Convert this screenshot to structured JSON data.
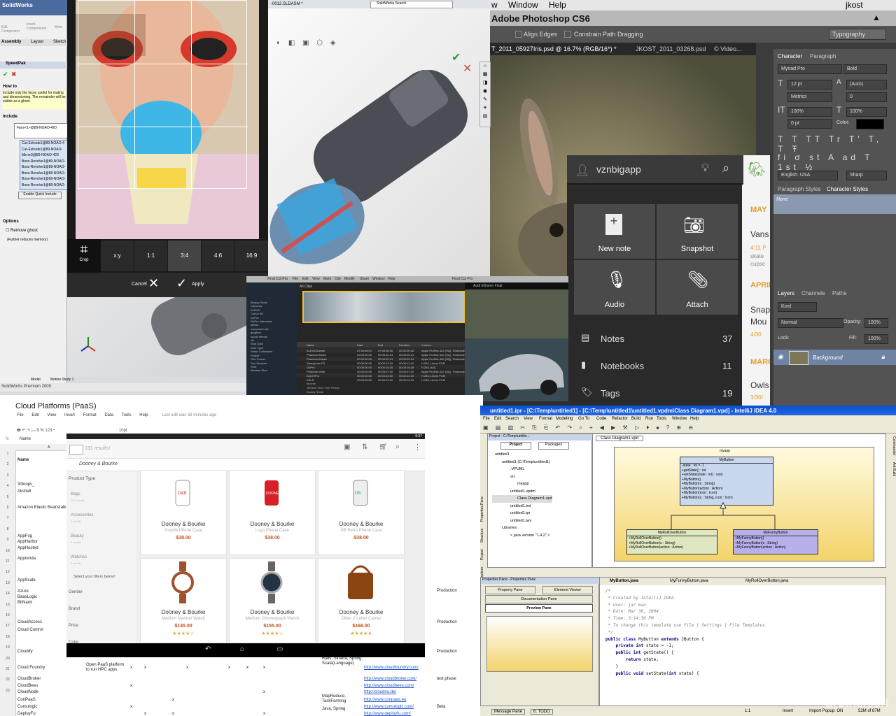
{
  "photoshop": {
    "menu": [
      "w",
      "Window",
      "Help"
    ],
    "user": "jkost",
    "app_title": "Adobe Photoshop CS6",
    "options": {
      "align_edges": "Align Edges",
      "constrain": "Constrain Path Dragging",
      "workspace": "Typography"
    },
    "doc_tabs": [
      "T_2011_05927Iris.psd @ 16.7% (RGB/16*) *",
      "JKOST_2011_03268.psd",
      "© Video..."
    ],
    "char_tabs": [
      "Character",
      "Paragraph"
    ],
    "font_family": "Myriad Pro",
    "font_style": "Bold",
    "font_size": "12 pt",
    "leading": "(Auto)",
    "kerning": "Metrics",
    "tracking": "0",
    "vscale": "100%",
    "hscale": "100%",
    "baseline": "0 pt",
    "color_label": "Color:",
    "language": "English: USA",
    "aa": "Sharp",
    "style_tabs": [
      "Paragraph Styles",
      "Character Styles"
    ],
    "style_none": "None",
    "layer_tabs": [
      "Layers",
      "Channels",
      "Paths"
    ],
    "kind": "Kind",
    "blend": "Normal",
    "opacity_label": "Opacity:",
    "opacity": "100%",
    "lock": "Lock:",
    "fill_label": "Fill:",
    "fill": "100%",
    "layer_name": "Background"
  },
  "evernote": {
    "user": "vznbigapp",
    "tiles": [
      "New note",
      "Snapshot",
      "Audio",
      "Attach"
    ],
    "list": [
      {
        "label": "Notes",
        "count": "37"
      },
      {
        "label": "Notebooks",
        "count": "11"
      },
      {
        "label": "Tags",
        "count": "19"
      }
    ],
    "side": [
      "MAY",
      "Vans",
      "4:11 P",
      "skate",
      "cupsc",
      "APRIL",
      "Snap",
      "Mou",
      "4/30",
      "MARC",
      "Owls",
      "3/30/"
    ]
  },
  "solidworks": {
    "logo": "SolidWorks",
    "file": "-0012.SLDASM *",
    "search": "SolidWorks Search",
    "tabs": [
      "Assembly",
      "Layout",
      "Sketch"
    ],
    "cmd": [
      "Edit Component",
      "Insert Components",
      "Mate"
    ],
    "panel_title": "SpeedPak",
    "howto": "How to",
    "help_text": "Include only the faces useful for mating and dimensioning. The remainder will be visible as a ghost.",
    "include": "Include",
    "face": "Face<1>@89-NOAO-420",
    "features": [
      "Cut-Extrude1@89-NOAO-4",
      "Cut-Extrude1@89-NOAO-",
      "Mirror3@89-NOAO-420",
      "Boss-Revolve1@89-NOAO-",
      "Boss-Revolve1@89-NOAO-",
      "Boss-Revolve1@89-NOAO-",
      "Boss-Revolve1@89-NOAO-",
      "Boss-Revolve1@89-NOAO-"
    ],
    "quick": "Enable Quick Include",
    "options": "Options",
    "remove_ghost": "Remove ghost",
    "reduce": "(Further reduces memory)",
    "bottom_tabs": [
      "Model",
      "Motion Study 1"
    ],
    "status": "SolidWorks Premium 2009"
  },
  "crop": {
    "tool": "Crop",
    "ratios": [
      "x:y",
      "1:1",
      "3:4",
      "4:6",
      "16:9"
    ],
    "selected_ratio": "3:4",
    "cancel": "Cancel",
    "apply": "Apply"
  },
  "finalcut": {
    "title": "Final Cut Pro",
    "menu": [
      "Final Cut Pro",
      "File",
      "Edit",
      "View",
      "Mark",
      "Clip",
      "Modify",
      "Share",
      "Window",
      "Help"
    ],
    "browser_title": "All Clips",
    "viewer_title": "Audi Infineon Final",
    "library": [
      "Beauty Shots",
      "Cameras",
      "ALEXA",
      "Canon 5D",
      "GoPro",
      "GoPro Interviews",
      "Media",
      "composed clip",
      "graphics",
      "sound effects",
      "vfx",
      "Shot Date",
      "Shot Type",
      "Smart Collections",
      "People",
      "One Person",
      "Two Persons",
      "Shot",
      "Medium Shot"
    ],
    "columns": [
      "Name",
      "Start",
      "End",
      "Duration",
      "Codecs"
    ],
    "clips": [
      [
        "ALEXA Sunset",
        "07:30:46:01",
        "07:45:08:16",
        "00:00:00:16",
        "Apple ProRes 422 (HQ), Timecode"
      ],
      [
        "Phantom Above",
        "00:00:00:00",
        "00:00:02:14",
        "00:00:02:14",
        "Apple ProRes 422 (HQ), Timecode"
      ],
      [
        "Phantom Ahead",
        "00:00:00:00",
        "00:00:02:14",
        "00:00:02:14",
        "Apple ProRes 422 (HQ), Timecode"
      ],
      [
        "Steadycam P3",
        "00:00:00:00",
        "00:00:12:10",
        "00:00:12:10",
        "H.264, Linear PCM"
      ],
      [
        "GoPro",
        "00:00:00:00",
        "00:00:16:28",
        "00:00:16:28",
        "H.264, AAC"
      ],
      [
        "Phantom Wide",
        "00:00:00:00",
        "00:00:07:20",
        "00:00:07:20",
        "Apple ProRes 422 (HQ), Timecode"
      ],
      [
        "AJA KiPro",
        "00:00:00:00",
        "00:00:12:10",
        "00:00:12:10",
        "H.264, Linear PCM"
      ],
      [
        "DSLR",
        "00:00:00:00",
        "00:00:12:10",
        "00:00:12:10",
        "H.264, Linear PCM"
      ]
    ],
    "keywords": [
      "favorite",
      "Medium Shot, One Person",
      "Beauty Shots",
      "Marker 1"
    ],
    "footer": "Audi Infineon Final",
    "timeline_tabs": [
      "Bring Race",
      "Tom Jones Long",
      "Bring In"
    ]
  },
  "sheet": {
    "title": "Cloud Platforms (PaaS)",
    "menu": [
      "File",
      "Edit",
      "View",
      "Insert",
      "Format",
      "Data",
      "Tools",
      "Help"
    ],
    "last_edit": "Last edit was 58 minutes ago",
    "font_size": "10pt",
    "formula_label": "fx",
    "formula": "Name",
    "col_a": "A",
    "header_row": "Name",
    "row_numbers": [
      "1",
      "2",
      "3",
      "4",
      "5",
      "6",
      "7",
      "8",
      "9",
      "10",
      "11",
      "12",
      "13",
      "14",
      "15",
      "16",
      "17",
      "18",
      "19",
      "20",
      "21",
      "22",
      "23"
    ],
    "names": [
      "30loops_",
      "Akshell",
      "Amazon Elastic Beanstalk",
      "AppFog",
      "AppHarbor",
      "AppHosted",
      "Apprenda",
      "AppScale",
      "Azure",
      "BaasLogic",
      "BitNami",
      "CloudAccess",
      "Cloud Control",
      "Cloudify",
      "Cloud Foundry",
      "CloudBroker",
      "CloudBees",
      "CloudNode",
      "ConPaaS",
      "Cumulogic",
      "DeployFu"
    ],
    "desc": "Open PaaS platform to run HPC apps",
    "lang1": "Rails, Sinatra, Spring; Scala(Language)",
    "lang2": "MapReduce, TaskFarming",
    "lang3": "Java, Spring",
    "links": [
      "http://www.cloudfoundry.com/",
      "http://www.cloudbroker.com/",
      "http://www.cloudbees.com/",
      "http://cloudno.de/",
      "http://www.conpaas.eu",
      "http://www.cumulogic.com/",
      "http://www.deployfu.com/"
    ],
    "statuses": [
      "Production",
      "Production",
      "Production",
      "test phase",
      "Beta"
    ],
    "x_mark": "x"
  },
  "shop": {
    "time": "9:37",
    "results": "191 results!",
    "query": "Dooney & Bourke",
    "filter_head": "Product Type",
    "filters": [
      {
        "name": "Bags",
        "count": "163 results"
      },
      {
        "name": "Accessories",
        "count": "4 results"
      },
      {
        "name": "Beauty",
        "count": "2 results"
      },
      {
        "name": "Watches",
        "count": "2 results"
      }
    ],
    "select_prompt": "Select your filters below!",
    "facets": [
      "Gender",
      "Brand",
      "Price",
      "Color"
    ],
    "products": [
      {
        "brand": "Dooney & Bourke",
        "name": "Doodle Phone Case",
        "price": "$38.00",
        "stars": ""
      },
      {
        "brand": "Dooney & Bourke",
        "name": "Logo Phone Case",
        "price": "$38.00",
        "stars": ""
      },
      {
        "brand": "Dooney & Bourke",
        "name": "DB Retro Phone Case",
        "price": "$38.00",
        "stars": ""
      },
      {
        "brand": "Dooney & Bourke",
        "name": "Medium Mariner Watch",
        "price": "$145.00",
        "stars": "★★★★☆"
      },
      {
        "brand": "Dooney & Bourke",
        "name": "Medium Chronograph Watch",
        "price": "$155.00",
        "stars": "★★★★☆"
      },
      {
        "brand": "Dooney & Bourke",
        "name": "Dillen 2 Letter Carrier",
        "price": "$168.00",
        "stars": "★★★★★"
      }
    ]
  },
  "intellij": {
    "title": "untitled1.ipr - [C:\\Temp\\untitled1] - [C:\\Temp\\untitled1\\untitled1.vpdm\\Class Diagram1.vpd] - IntelliJ IDEA 4.0",
    "menu": [
      "File",
      "Edit",
      "Search",
      "View",
      "Format",
      "Modeling",
      "Go To",
      "Code",
      "Refactor",
      "Build",
      "Run",
      "Tools",
      "Window",
      "Help"
    ],
    "project_title": "Project - C:\\Temp\\untitle...",
    "proj_tabs": [
      "Project",
      "Packages"
    ],
    "tree": [
      "untitled1",
      "untitled1  (C:\\Temp\\untitled1)",
      ".VPUML",
      "src",
      "myapp",
      "untitled1.vpdm",
      "Class Diagram1.vpd",
      "untitled1.iml",
      "untitled1.ipr",
      "untitled1.iws",
      "Libraries",
      "< java version \"1.4.2\" >"
    ],
    "diagram_tab": "Class Diagram1.vpd",
    "package": "myapp",
    "classes": [
      {
        "name": "MyButton",
        "members": [
          "-state : int = -1",
          "+getState() : int",
          "+setState(state : int) : void",
          "+MyButton()",
          "+MyButton(s : String)",
          "+MyButton(action : Action)",
          "+MyButton(icon : Icon)",
          "+MyButton(s : String, icon : Icon)"
        ]
      },
      {
        "name": "MyRollOverButton",
        "members": [
          "+MyRollOverButton()",
          "+MyRollOverButton(s : String)",
          "+MyRollOverButton(action : Action)"
        ]
      },
      {
        "name": "MyFunnyButton",
        "members": [
          "+MyFunnyButton()",
          "+MyFunnyButton(s : String)",
          "+MyFunnyButton(action : Action)"
        ]
      }
    ],
    "props_title": "Properties Pane - Properties Pane",
    "props_buttons": [
      "Property Pane",
      "Element Viewer",
      "Documentation Pane",
      "Preview Pane"
    ],
    "file_tabs": [
      "MyButton.java",
      "MyFunnyButton.java",
      "MyRollOverButton.java"
    ],
    "code": [
      "/*",
      " * Created by IntelliJ IDEA.",
      " * User: jar man",
      " * Date: Mar 30, 2004",
      " * Time: 3:14:36 PM",
      " * To change this template use File | Settings | File Templates.",
      " */",
      "public class MyButton extends JButton {",
      "    private int state = -1;",
      "",
      "    public int getState() {",
      "        return state;",
      "    }",
      "",
      "    public void setState(int state) {"
    ],
    "side_tabs": [
      "Project Explorer",
      "Project",
      "Structure",
      "Properties Pane"
    ],
    "right_tabs": [
      "Commander",
      "Ant Build"
    ],
    "bottom_tabs": [
      "Message Pane",
      "6: TODO"
    ],
    "status": [
      "1:1",
      "Insert",
      "Import Popup: ON",
      "52M of 87M"
    ]
  },
  "watermark": "Brothersoft"
}
